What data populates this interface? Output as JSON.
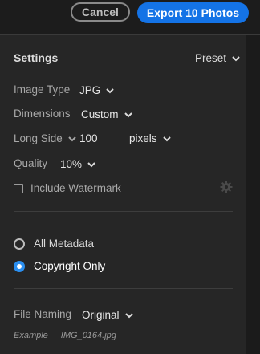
{
  "header": {
    "cancel_label": "Cancel",
    "export_label": "Export 10 Photos"
  },
  "settings": {
    "title": "Settings",
    "preset_label": "Preset",
    "image_type": {
      "label": "Image Type",
      "value": "JPG"
    },
    "dimensions": {
      "label": "Dimensions",
      "value": "Custom"
    },
    "long_side": {
      "label": "Long Side",
      "value": "100",
      "unit": "pixels"
    },
    "quality": {
      "label": "Quality",
      "value": "10%"
    },
    "watermark": {
      "label": "Include Watermark",
      "checked": false
    }
  },
  "metadata": {
    "options": [
      {
        "label": "All Metadata",
        "selected": false
      },
      {
        "label": "Copyright Only",
        "selected": true
      }
    ]
  },
  "file_naming": {
    "label": "File Naming",
    "value": "Original",
    "example_label": "Example",
    "example_value": "IMG_0164.jpg"
  },
  "colors": {
    "accent": "#1473e6",
    "background": "#262626"
  }
}
